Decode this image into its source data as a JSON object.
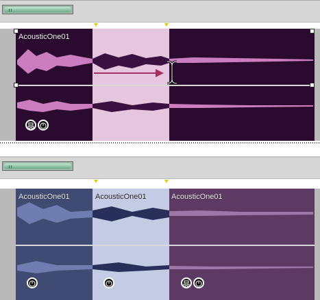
{
  "colors": {
    "top_clip_bg": "#2a0a2e",
    "top_selection_bg": "#e6c6de",
    "wave_pink": "#cc7dc0",
    "wave_dark": "#3a1040",
    "bottom_clip1_bg": "#3f4b72",
    "bottom_clip2_bg": "#c3cbe5",
    "bottom_clip3_bg": "#5d3a63",
    "arrow": "#a3305f",
    "marker": "#e1d000"
  },
  "top_panel": {
    "clip_name": "AcousticOne01",
    "icons": [
      "mixer-icon",
      "clock-icon"
    ],
    "action": "drag-to-resize"
  },
  "bottom_panel": {
    "clips": [
      {
        "name": "AcousticOne01",
        "icons": [
          "clock-icon"
        ]
      },
      {
        "name": "AcousticOne01",
        "icons": [
          "clock-icon"
        ]
      },
      {
        "name": "AcousticOne01",
        "icons": [
          "mixer-icon",
          "clock-icon"
        ]
      }
    ]
  }
}
